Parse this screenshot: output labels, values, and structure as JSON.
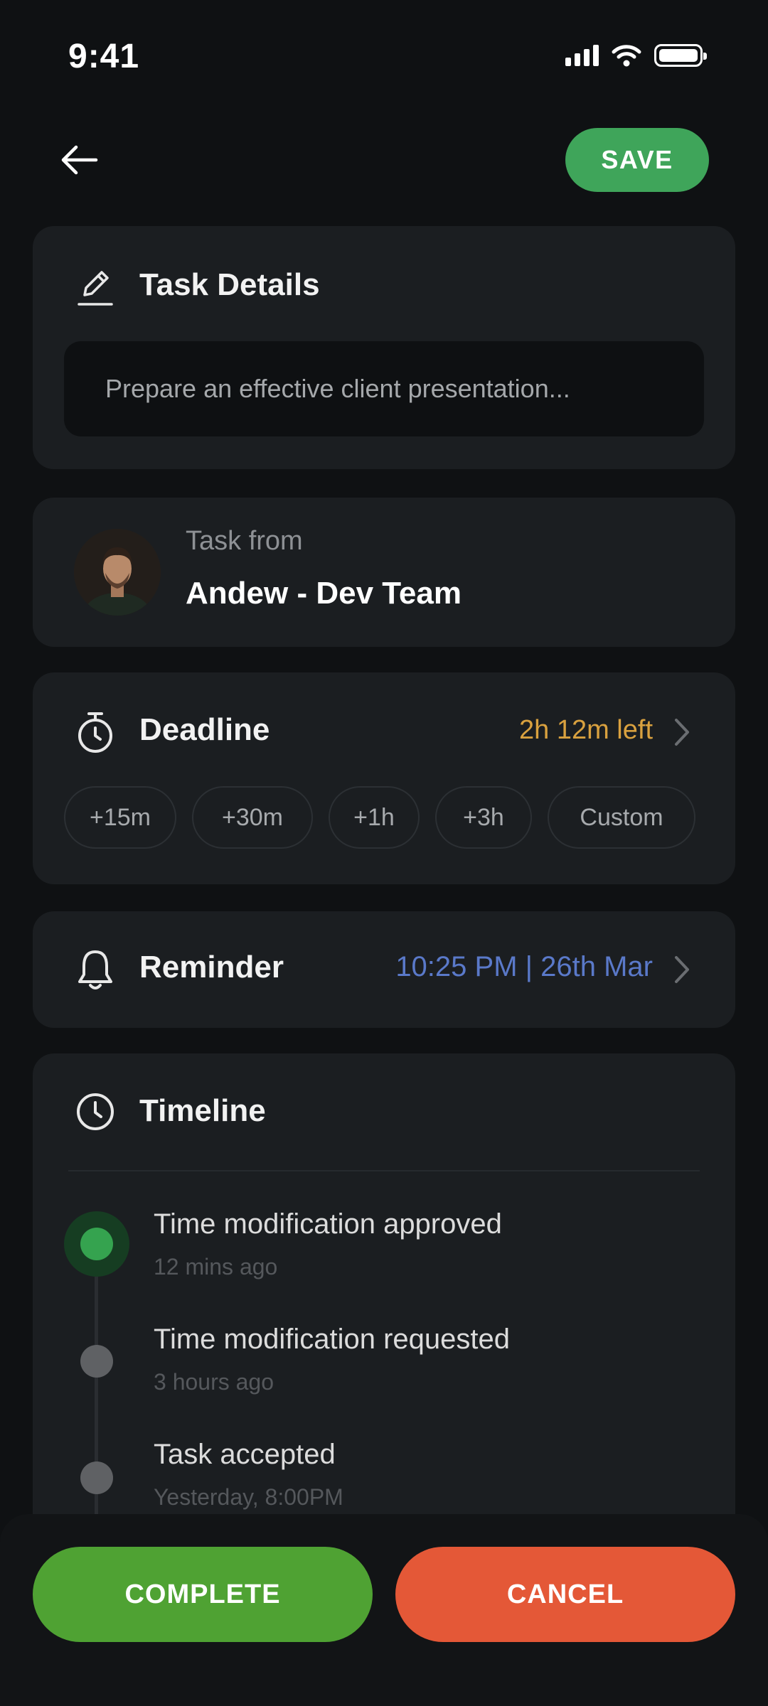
{
  "status_bar": {
    "time": "9:41",
    "icons": [
      "cellular-signal-icon",
      "wifi-icon",
      "battery-icon"
    ]
  },
  "header": {
    "back_icon": "arrow-left-icon",
    "save_label": "SAVE"
  },
  "task_details": {
    "title": "Task Details",
    "icon": "pencil-icon",
    "input_placeholder": "Prepare an effective client presentation..."
  },
  "task_from": {
    "label": "Task from",
    "name": "Andew - Dev Team"
  },
  "deadline": {
    "title": "Deadline",
    "icon": "stopwatch-icon",
    "value": "2h 12m left",
    "options": [
      "+15m",
      "+30m",
      "+1h",
      "+3h",
      "Custom"
    ]
  },
  "reminder": {
    "title": "Reminder",
    "icon": "bell-icon",
    "value": "10:25 PM | 26th Mar"
  },
  "timeline": {
    "title": "Timeline",
    "icon": "clock-icon",
    "events": [
      {
        "title": "Time modification approved",
        "time": "12 mins ago",
        "status": "active"
      },
      {
        "title": "Time modification requested",
        "time": "3 hours ago",
        "status": "past"
      },
      {
        "title": "Task accepted",
        "time": "Yesterday, 8:00PM",
        "status": "past"
      }
    ]
  },
  "actions": {
    "complete_label": "COMPLETE",
    "cancel_label": "CANCEL"
  },
  "colors": {
    "background": "#0f1113",
    "card": "#1b1e21",
    "save_green": "#3fa55a",
    "complete_green": "#4fa233",
    "cancel_orange": "#e45837",
    "deadline_amber": "#d9a13f",
    "reminder_blue": "#5a79c9"
  }
}
